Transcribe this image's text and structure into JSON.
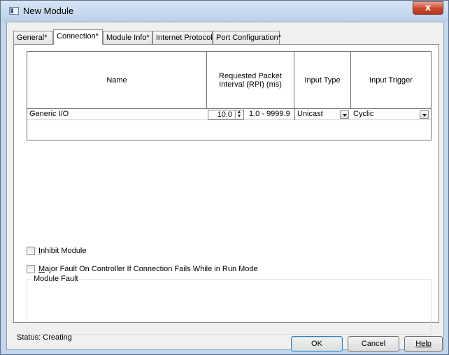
{
  "window": {
    "title": "New Module",
    "close_glyph": "x"
  },
  "tabs": [
    {
      "label": "General*",
      "active": false
    },
    {
      "label": "Connection*",
      "active": true
    },
    {
      "label": "Module Info*",
      "active": false
    },
    {
      "label": "Internet Protocol*",
      "active": false
    },
    {
      "label": "Port Configuration*",
      "active": false
    }
  ],
  "grid": {
    "headers": {
      "name": "Name",
      "rpi": "Requested Packet Interval (RPI) (ms)",
      "input_type": "Input Type",
      "input_trigger": "Input Trigger"
    },
    "rows": [
      {
        "name": "Generic I/O",
        "rpi_value": "10.0",
        "rpi_range": "1.0 - 9999.9",
        "input_type": "Unicast",
        "input_trigger": "Cyclic"
      }
    ]
  },
  "options": {
    "inhibit_module": {
      "label_underline": "I",
      "label_rest": "nhibit Module",
      "checked": false
    },
    "major_fault": {
      "label_underline": "M",
      "label_rest": "ajor Fault On Controller If Connection Fails While in Run Mode",
      "checked": false
    }
  },
  "module_fault": {
    "title": "Module Fault",
    "text": ""
  },
  "footer": {
    "status": "Status:  Creating",
    "ok_label": "OK",
    "cancel_label": "Cancel",
    "help_label": "Help"
  }
}
